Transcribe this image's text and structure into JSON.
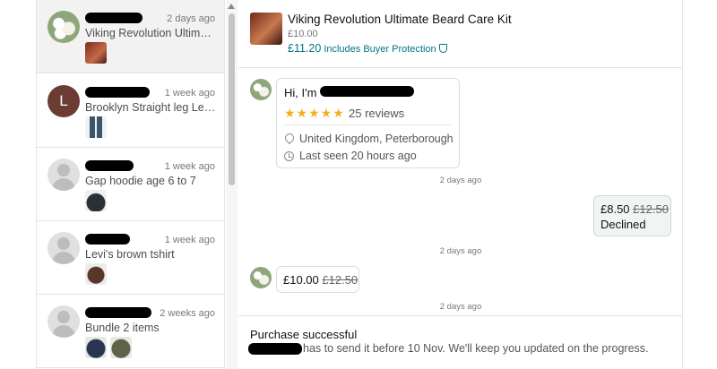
{
  "inbox": {
    "conversations": [
      {
        "time": "2 days ago",
        "title": "Viking Revolution Ultim…"
      },
      {
        "avatar_letter": "L",
        "time": "1 week ago",
        "title": "Brooklyn Straight leg Le…"
      },
      {
        "time": "1 week ago",
        "title": "Gap hoodie age 6 to 7"
      },
      {
        "time": "1 week ago",
        "title": "Levi's brown tshirt"
      },
      {
        "time": "2 weeks ago",
        "title": "Bundle 2 items"
      }
    ]
  },
  "item": {
    "title": "Viking Revolution Ultimate Beard Care Kit",
    "price": "£10.00",
    "total": "£11.20",
    "buyer_protection": "Includes Buyer Protection"
  },
  "profile_card": {
    "greeting": "Hi, I'm",
    "stars": "★★★★★",
    "reviews": "25 reviews",
    "location": "United Kingdom, Peterborough",
    "last_seen": "Last seen 20 hours ago"
  },
  "messages": {
    "stamp1": "2 days ago",
    "offer_out_new": "£8.50",
    "offer_out_old": "£12.50",
    "offer_out_status": "Declined",
    "stamp2": "2 days ago",
    "offer_in_new": "£10.00",
    "offer_in_old": "£12.50",
    "stamp3": "2 days ago"
  },
  "purchase": {
    "title": "Purchase successful",
    "text": "has to send it before 10 Nov. We'll keep you updated on the progress."
  },
  "colors": {
    "accent": "#007782",
    "stars": "#f2b01e"
  }
}
